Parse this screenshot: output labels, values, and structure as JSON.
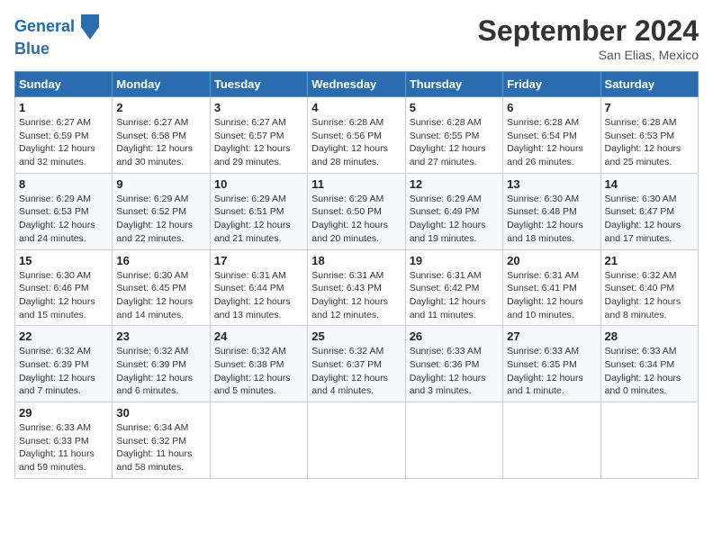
{
  "header": {
    "logo_line1": "General",
    "logo_line2": "Blue",
    "month_title": "September 2024",
    "location": "San Elias, Mexico"
  },
  "weekdays": [
    "Sunday",
    "Monday",
    "Tuesday",
    "Wednesday",
    "Thursday",
    "Friday",
    "Saturday"
  ],
  "weeks": [
    [
      {
        "day": "1",
        "sunrise": "6:27 AM",
        "sunset": "6:59 PM",
        "daylight": "12 hours and 32 minutes."
      },
      {
        "day": "2",
        "sunrise": "6:27 AM",
        "sunset": "6:58 PM",
        "daylight": "12 hours and 30 minutes."
      },
      {
        "day": "3",
        "sunrise": "6:27 AM",
        "sunset": "6:57 PM",
        "daylight": "12 hours and 29 minutes."
      },
      {
        "day": "4",
        "sunrise": "6:28 AM",
        "sunset": "6:56 PM",
        "daylight": "12 hours and 28 minutes."
      },
      {
        "day": "5",
        "sunrise": "6:28 AM",
        "sunset": "6:55 PM",
        "daylight": "12 hours and 27 minutes."
      },
      {
        "day": "6",
        "sunrise": "6:28 AM",
        "sunset": "6:54 PM",
        "daylight": "12 hours and 26 minutes."
      },
      {
        "day": "7",
        "sunrise": "6:28 AM",
        "sunset": "6:53 PM",
        "daylight": "12 hours and 25 minutes."
      }
    ],
    [
      {
        "day": "8",
        "sunrise": "6:29 AM",
        "sunset": "6:53 PM",
        "daylight": "12 hours and 24 minutes."
      },
      {
        "day": "9",
        "sunrise": "6:29 AM",
        "sunset": "6:52 PM",
        "daylight": "12 hours and 22 minutes."
      },
      {
        "day": "10",
        "sunrise": "6:29 AM",
        "sunset": "6:51 PM",
        "daylight": "12 hours and 21 minutes."
      },
      {
        "day": "11",
        "sunrise": "6:29 AM",
        "sunset": "6:50 PM",
        "daylight": "12 hours and 20 minutes."
      },
      {
        "day": "12",
        "sunrise": "6:29 AM",
        "sunset": "6:49 PM",
        "daylight": "12 hours and 19 minutes."
      },
      {
        "day": "13",
        "sunrise": "6:30 AM",
        "sunset": "6:48 PM",
        "daylight": "12 hours and 18 minutes."
      },
      {
        "day": "14",
        "sunrise": "6:30 AM",
        "sunset": "6:47 PM",
        "daylight": "12 hours and 17 minutes."
      }
    ],
    [
      {
        "day": "15",
        "sunrise": "6:30 AM",
        "sunset": "6:46 PM",
        "daylight": "12 hours and 15 minutes."
      },
      {
        "day": "16",
        "sunrise": "6:30 AM",
        "sunset": "6:45 PM",
        "daylight": "12 hours and 14 minutes."
      },
      {
        "day": "17",
        "sunrise": "6:31 AM",
        "sunset": "6:44 PM",
        "daylight": "12 hours and 13 minutes."
      },
      {
        "day": "18",
        "sunrise": "6:31 AM",
        "sunset": "6:43 PM",
        "daylight": "12 hours and 12 minutes."
      },
      {
        "day": "19",
        "sunrise": "6:31 AM",
        "sunset": "6:42 PM",
        "daylight": "12 hours and 11 minutes."
      },
      {
        "day": "20",
        "sunrise": "6:31 AM",
        "sunset": "6:41 PM",
        "daylight": "12 hours and 10 minutes."
      },
      {
        "day": "21",
        "sunrise": "6:32 AM",
        "sunset": "6:40 PM",
        "daylight": "12 hours and 8 minutes."
      }
    ],
    [
      {
        "day": "22",
        "sunrise": "6:32 AM",
        "sunset": "6:39 PM",
        "daylight": "12 hours and 7 minutes."
      },
      {
        "day": "23",
        "sunrise": "6:32 AM",
        "sunset": "6:39 PM",
        "daylight": "12 hours and 6 minutes."
      },
      {
        "day": "24",
        "sunrise": "6:32 AM",
        "sunset": "6:38 PM",
        "daylight": "12 hours and 5 minutes."
      },
      {
        "day": "25",
        "sunrise": "6:32 AM",
        "sunset": "6:37 PM",
        "daylight": "12 hours and 4 minutes."
      },
      {
        "day": "26",
        "sunrise": "6:33 AM",
        "sunset": "6:36 PM",
        "daylight": "12 hours and 3 minutes."
      },
      {
        "day": "27",
        "sunrise": "6:33 AM",
        "sunset": "6:35 PM",
        "daylight": "12 hours and 1 minute."
      },
      {
        "day": "28",
        "sunrise": "6:33 AM",
        "sunset": "6:34 PM",
        "daylight": "12 hours and 0 minutes."
      }
    ],
    [
      {
        "day": "29",
        "sunrise": "6:33 AM",
        "sunset": "6:33 PM",
        "daylight": "11 hours and 59 minutes."
      },
      {
        "day": "30",
        "sunrise": "6:34 AM",
        "sunset": "6:32 PM",
        "daylight": "11 hours and 58 minutes."
      },
      null,
      null,
      null,
      null,
      null
    ]
  ]
}
